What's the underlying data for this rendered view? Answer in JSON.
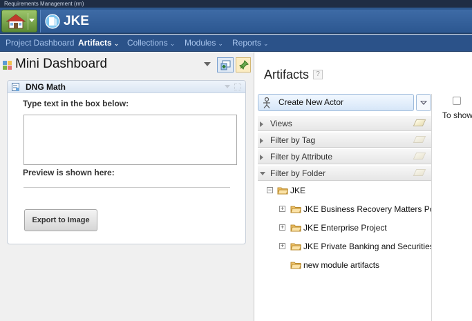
{
  "app": {
    "title": "Requirements Management (rm)",
    "project_name": "JKE"
  },
  "nav": {
    "items": [
      {
        "label": "Project Dashboard",
        "has_menu": false,
        "active": false
      },
      {
        "label": "Artifacts",
        "has_menu": true,
        "active": true
      },
      {
        "label": "Collections",
        "has_menu": true,
        "active": false
      },
      {
        "label": "Modules",
        "has_menu": true,
        "active": false
      },
      {
        "label": "Reports",
        "has_menu": true,
        "active": false
      }
    ],
    "chevron": "⌄"
  },
  "mini_dashboard": {
    "title": "Mini Dashboard",
    "widget": {
      "title": "DNG Math",
      "input_label": "Type text in the box below:",
      "input_value": "",
      "preview_label": "Preview is shown here:",
      "export_label": "Export to Image"
    }
  },
  "artifacts": {
    "title": "Artifacts",
    "help": "?",
    "create_label": "Create New Actor",
    "sections": [
      {
        "label": "Views",
        "expanded": false
      },
      {
        "label": "Filter by Tag",
        "expanded": false
      },
      {
        "label": "Filter by Attribute",
        "expanded": false
      },
      {
        "label": "Filter by Folder",
        "expanded": true
      }
    ],
    "folder_tree": {
      "root": "JKE",
      "children": [
        "JKE Business Recovery Matters Portfolio",
        "JKE Enterprise Project",
        "JKE Private Banking and Securities Project",
        "new module artifacts"
      ]
    },
    "empty_text": "To show"
  },
  "colors": {
    "header_blue": "#2f5a92",
    "nav_blue": "#2b5289",
    "accent_green": "#5d8a33"
  },
  "icons": {
    "home": "home-icon",
    "project": "project-icon",
    "dashboard": "dashboard-grid-icon",
    "add_widget": "add-widget-icon",
    "pin": "pin-icon",
    "widget": "math-widget-icon",
    "actor": "actor-icon",
    "folder": "folder-icon",
    "eraser": "eraser-icon"
  }
}
